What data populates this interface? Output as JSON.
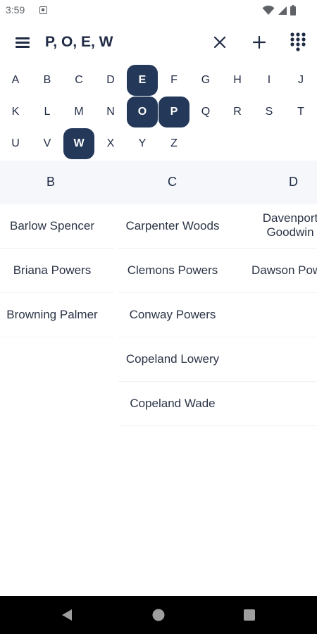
{
  "status_bar": {
    "time": "3:59",
    "icons": [
      "notification-icon",
      "wifi-icon",
      "signal-icon",
      "battery-icon"
    ]
  },
  "toolbar": {
    "title": "P, O, E, W",
    "icons": [
      "menu-icon",
      "close-icon",
      "add-icon",
      "dialpad-icon"
    ]
  },
  "alphabet": {
    "rows": [
      [
        "A",
        "B",
        "C",
        "D",
        "E",
        "F",
        "G",
        "H",
        "I",
        "J"
      ],
      [
        "K",
        "L",
        "M",
        "N",
        "O",
        "P",
        "Q",
        "R",
        "S",
        "T"
      ],
      [
        "U",
        "V",
        "W",
        "X",
        "Y",
        "Z"
      ]
    ],
    "selected": [
      "E",
      "O",
      "P",
      "W"
    ],
    "selected_color": "#24395a"
  },
  "columns": {
    "headers": [
      "B",
      "C",
      "D"
    ],
    "b_items": [
      "Barlow Spencer",
      "Briana Powers",
      "Browning Palmer"
    ],
    "c_items": [
      "Carpenter Woods",
      "Clemons Powers",
      "Conway Powers",
      "Copeland Lowery",
      "Copeland Wade"
    ],
    "d_items": [
      "Davenport Goodwin",
      "Dawson Powers"
    ]
  },
  "nav_bar": {
    "icons": [
      "back-icon",
      "home-icon",
      "recents-icon"
    ]
  }
}
